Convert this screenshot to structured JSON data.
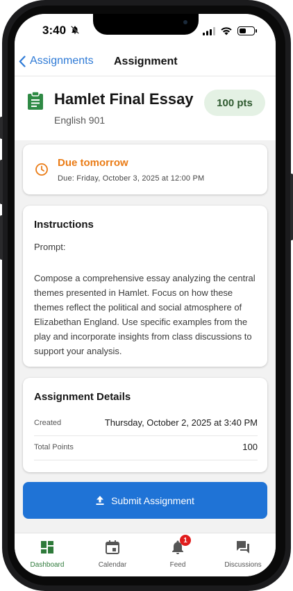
{
  "status": {
    "time": "3:40"
  },
  "nav": {
    "back_label": "Assignments",
    "title": "Assignment"
  },
  "assignment": {
    "title": "Hamlet Final Essay",
    "course": "English 901",
    "points_badge": "100 pts"
  },
  "due": {
    "title": "Due tomorrow",
    "date": "Due: Friday, October 3, 2025 at 12:00 PM"
  },
  "instructions": {
    "heading": "Instructions",
    "prompt_label": "Prompt:",
    "body": "Compose a comprehensive essay analyzing the central themes presented in Hamlet. Focus on how these themes reflect the political and social atmosphere of Elizabethan England. Use specific examples from the play and incorporate insights from class discussions to support your analysis."
  },
  "details": {
    "heading": "Assignment Details",
    "rows": [
      {
        "key": "Created",
        "value": "Thursday, October 2, 2025 at 3:40 PM"
      },
      {
        "key": "Total Points",
        "value": "100"
      }
    ]
  },
  "submit_label": "Submit Assignment",
  "tabs": [
    {
      "label": "Dashboard",
      "icon": "dashboard-icon",
      "active": true
    },
    {
      "label": "Calendar",
      "icon": "calendar-icon",
      "active": false
    },
    {
      "label": "Feed",
      "icon": "bell-icon",
      "active": false,
      "badge": "1"
    },
    {
      "label": "Discussions",
      "icon": "forum-icon",
      "active": false
    }
  ],
  "colors": {
    "accent": "#1f73d6",
    "due": "#ea7b15",
    "badge_bg": "#e4f1e4",
    "active_tab": "#2e7a3a",
    "notification": "#e11d1d"
  }
}
